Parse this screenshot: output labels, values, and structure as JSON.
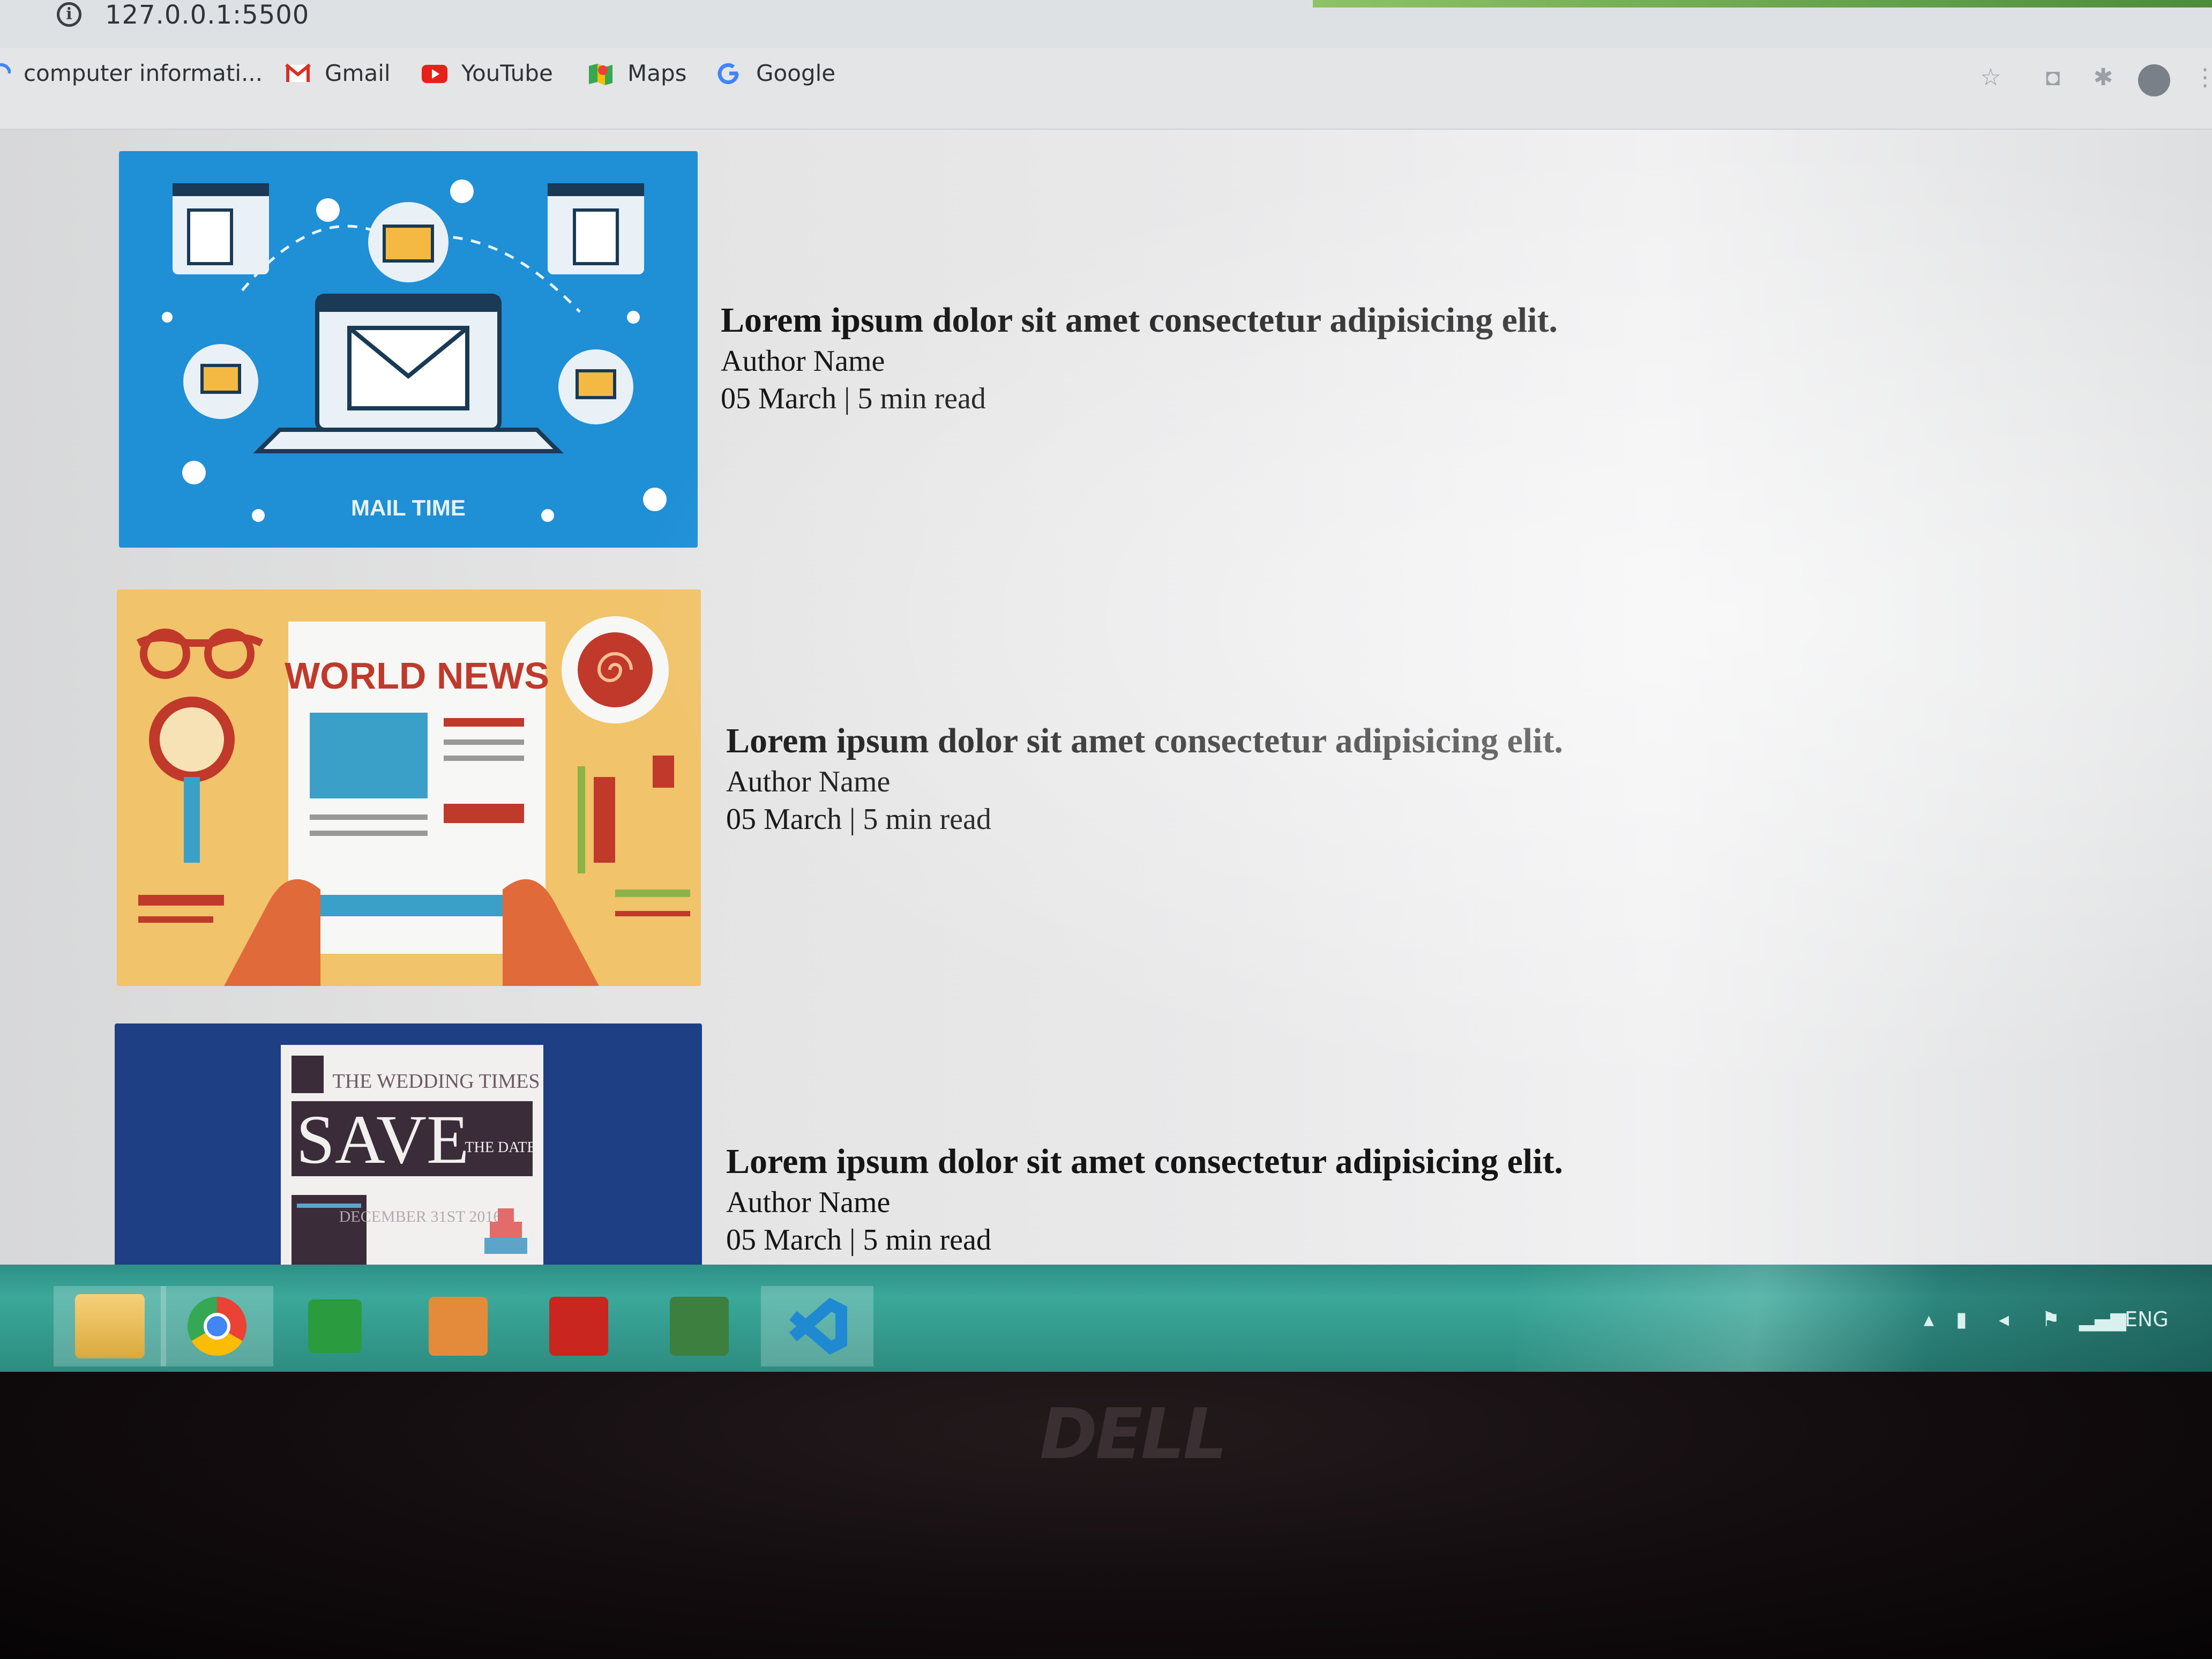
{
  "browser": {
    "url": "127.0.0.1:5500",
    "bookmarks": [
      {
        "label": "computer informati...",
        "icon": "google-g-icon"
      },
      {
        "label": "Gmail",
        "icon": "gmail-icon"
      },
      {
        "label": "YouTube",
        "icon": "youtube-icon"
      },
      {
        "label": "Maps",
        "icon": "maps-icon"
      },
      {
        "label": "Google",
        "icon": "google-icon"
      }
    ]
  },
  "posts": [
    {
      "title": "Lorem ipsum dolor sit amet consectetur adipisicing elit.",
      "author": "Author Name",
      "meta": "05 March | 5 min read",
      "thumbnail_text": "MAIL TIME"
    },
    {
      "title": "Lorem ipsum dolor sit amet consectetur adipisicing elit.",
      "author": "Author Name",
      "meta": "05 March | 5 min read",
      "thumbnail_text": "WORLD NEWS"
    },
    {
      "title": "Lorem ipsum dolor sit amet consectetur adipisicing elit.",
      "author": "Author Name",
      "meta": "05 March | 5 min read",
      "thumbnail_text": "SAVE",
      "thumbnail_header": "THE WEDDING TIMES",
      "thumbnail_small": "THE DATE",
      "thumbnail_date": "DECEMBER 31ST 2016"
    }
  ],
  "taskbar": {
    "apps": [
      "file-explorer-icon",
      "chrome-icon",
      "store-icon",
      "sway-icon",
      "teams-icon",
      "project-icon",
      "vscode-icon"
    ],
    "tray_language": "ENG"
  },
  "bezel_brand": "DELL"
}
